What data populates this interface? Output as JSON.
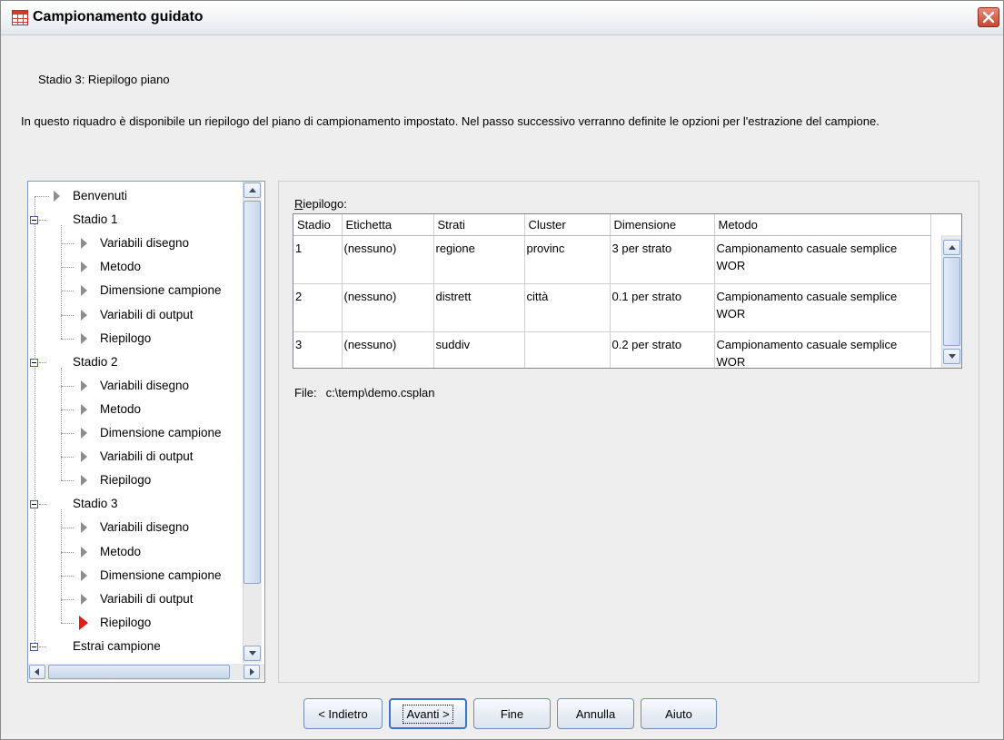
{
  "window": {
    "title": "Campionamento guidato",
    "icons": {
      "app": "spreadsheet-icon",
      "close": "close-icon"
    }
  },
  "stage_title": "Stadio 3: Riepilogo piano",
  "description": "In questo riquadro è disponibile un riepilogo del piano di campionamento impostato. Nel passo successivo verranno definite le opzioni per l'estrazione del campione.",
  "tree": {
    "items": [
      {
        "label": "Benvenuti",
        "kind": "leaf"
      },
      {
        "label": "Stadio 1",
        "kind": "group"
      },
      {
        "label": "Variabili disegno",
        "kind": "leaf"
      },
      {
        "label": "Metodo",
        "kind": "leaf"
      },
      {
        "label": "Dimensione campione",
        "kind": "leaf"
      },
      {
        "label": "Variabili di output",
        "kind": "leaf"
      },
      {
        "label": "Riepilogo",
        "kind": "leaf"
      },
      {
        "label": "Stadio 2",
        "kind": "group"
      },
      {
        "label": "Variabili disegno",
        "kind": "leaf"
      },
      {
        "label": "Metodo",
        "kind": "leaf"
      },
      {
        "label": "Dimensione campione",
        "kind": "leaf"
      },
      {
        "label": "Variabili di output",
        "kind": "leaf"
      },
      {
        "label": "Riepilogo",
        "kind": "leaf"
      },
      {
        "label": "Stadio 3",
        "kind": "group"
      },
      {
        "label": "Variabili disegno",
        "kind": "leaf"
      },
      {
        "label": "Metodo",
        "kind": "leaf"
      },
      {
        "label": "Dimensione campione",
        "kind": "leaf"
      },
      {
        "label": "Variabili di output",
        "kind": "leaf"
      },
      {
        "label": "Riepilogo",
        "kind": "leaf",
        "selected": true
      },
      {
        "label": "Estrai campione",
        "kind": "group"
      }
    ]
  },
  "summary": {
    "label_prefix": "R",
    "label_rest": "iepilogo:",
    "columns": [
      "Stadio",
      "Etichetta",
      "Strati",
      "Cluster",
      "Dimensione",
      "Metodo"
    ],
    "rows": [
      [
        "1",
        "(nessuno)",
        "regione",
        "provinc",
        "3 per strato",
        "Campionamento casuale semplice WOR"
      ],
      [
        "2",
        "(nessuno)",
        "distrett",
        "città",
        "0.1 per strato",
        "Campionamento casuale semplice WOR"
      ],
      [
        "3",
        "(nessuno)",
        "suddiv",
        "",
        "0.2 per strato",
        "Campionamento casuale semplice WOR"
      ]
    ]
  },
  "file": {
    "label": "File:",
    "path": "c:\\temp\\demo.csplan"
  },
  "buttons": {
    "back": "< Indietro",
    "next": "Avanti >",
    "finish": "Fine",
    "cancel": "Annulla",
    "help": "Aiuto"
  },
  "colors": {
    "accent": "#3a74c9",
    "selected_marker": "#e31b1b",
    "close": "#c94431"
  }
}
